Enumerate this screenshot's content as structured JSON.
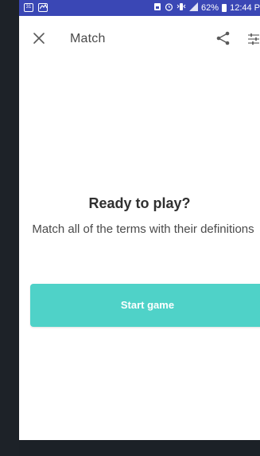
{
  "status_bar": {
    "left_icons": [
      "31",
      "gallery"
    ],
    "right_text": "62%",
    "time": "12:44 P",
    "icons": [
      "sim-icon",
      "alarm-icon",
      "vibrate-icon",
      "signal-icon",
      "battery-icon"
    ]
  },
  "toolbar": {
    "title": "Match"
  },
  "content": {
    "heading": "Ready to play?",
    "subtitle": "Match all of the terms with their definitions",
    "start_button": "Start game"
  },
  "colors": {
    "status_bar": "#3a47b5",
    "accent": "#4fd2c8",
    "background": "#ffffff",
    "outer": "#1c2127"
  }
}
